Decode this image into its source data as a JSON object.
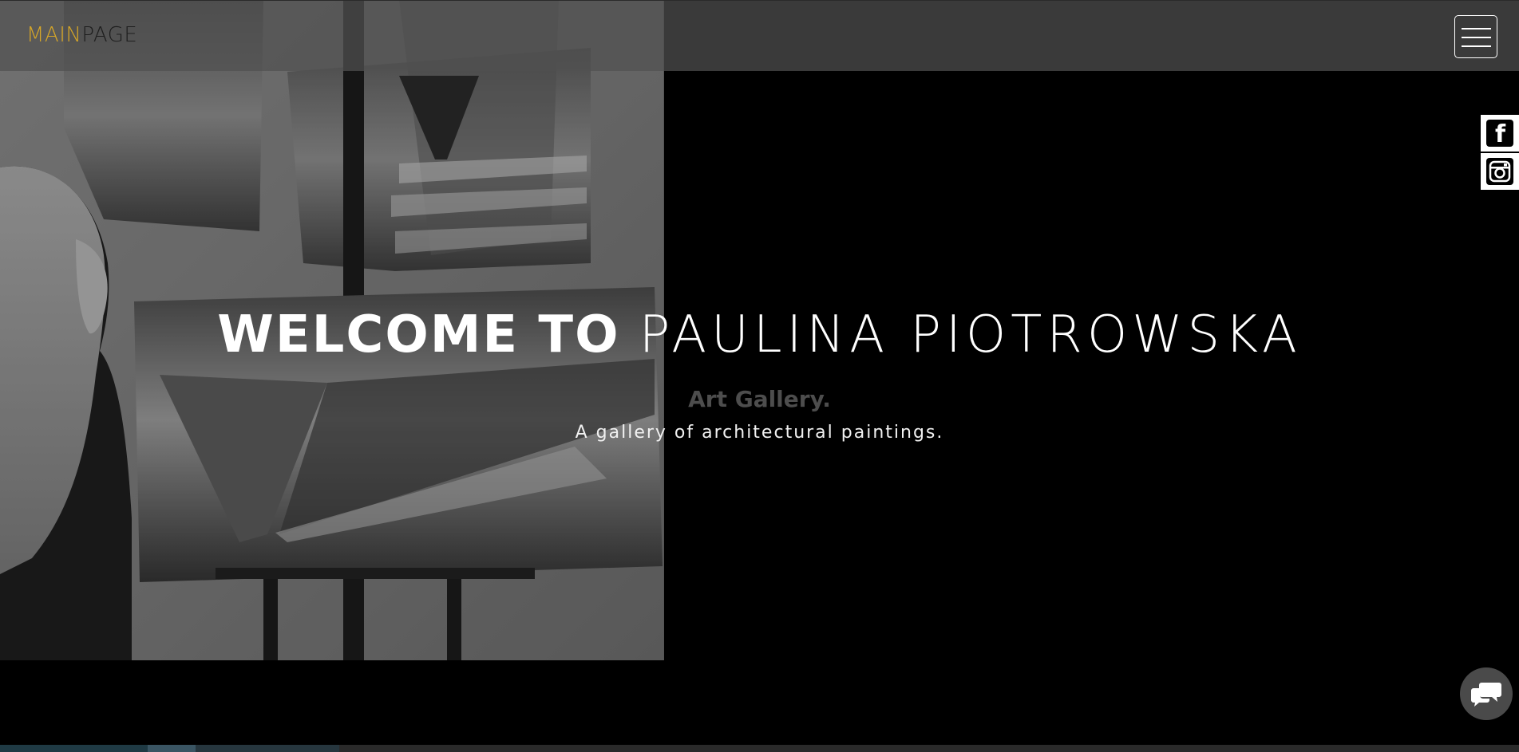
{
  "navbar": {
    "brand_main": "MAIN",
    "brand_page": "PAGE"
  },
  "hero": {
    "title_strong": "WELCOME TO",
    "title_light": "PAULINA PIOTROWSKA",
    "subtitle": "Art Gallery.",
    "description": "A gallery of architectural paintings."
  },
  "social": [
    {
      "name": "facebook",
      "icon": "facebook-icon"
    },
    {
      "name": "instagram",
      "icon": "instagram-icon"
    }
  ],
  "icons": {
    "menu": "hamburger-menu-icon",
    "chat": "chat-bubbles-icon"
  },
  "colors": {
    "brand_accent": "#d6a628",
    "brand_dark": "#1d1d1d",
    "navbar_bg": "#505050",
    "page_bg": "#000000",
    "subtitle": "#4d4d4d"
  }
}
